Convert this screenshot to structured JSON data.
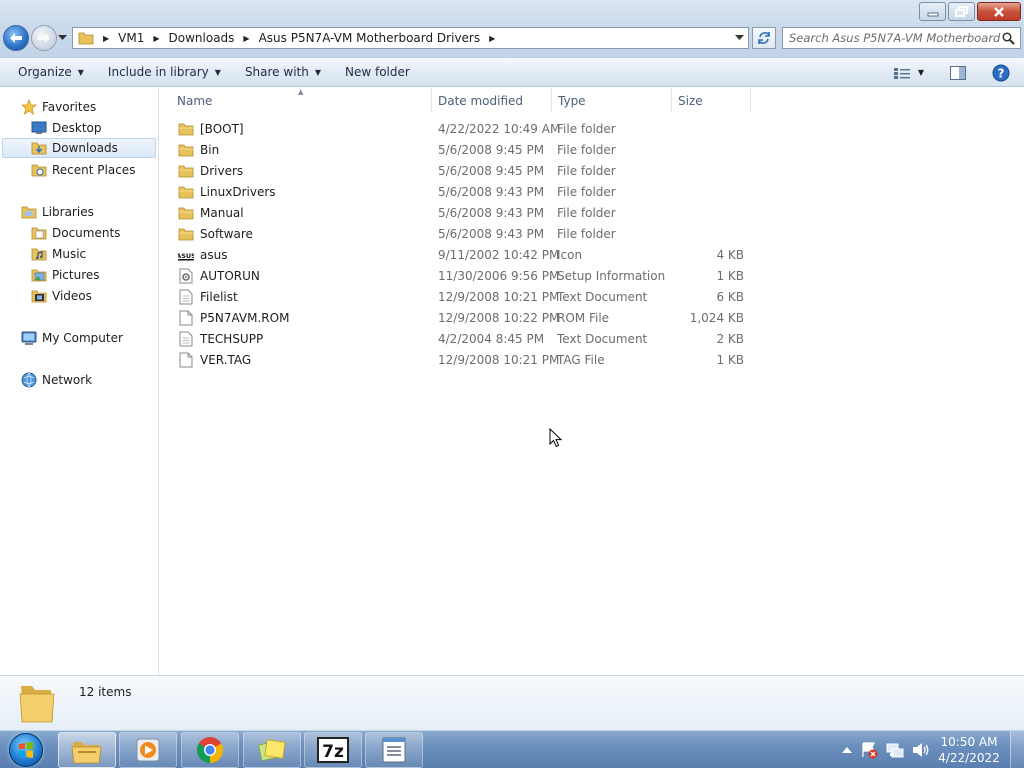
{
  "window": {
    "breadcrumb": [
      "VM1",
      "Downloads",
      "Asus P5N7A-VM Motherboard Drivers"
    ],
    "search_placeholder": "Search Asus P5N7A-VM Motherboard ...",
    "controls": [
      "minimize-icon",
      "maximize-icon",
      "close-icon"
    ]
  },
  "toolbar": {
    "organize": "Organize",
    "include_in_library": "Include in library",
    "share_with": "Share with",
    "new_folder": "New folder",
    "right_icons": [
      "views-icon",
      "preview-pane-icon",
      "help-icon"
    ]
  },
  "nav": {
    "favorites": "Favorites",
    "desktop": "Desktop",
    "downloads": "Downloads",
    "recent_places": "Recent Places",
    "libraries": "Libraries",
    "documents": "Documents",
    "music": "Music",
    "pictures": "Pictures",
    "videos": "Videos",
    "my_computer": "My Computer",
    "network": "Network",
    "selected": "Downloads"
  },
  "columns": {
    "name": "Name",
    "date_modified": "Date modified",
    "type": "Type",
    "size": "Size"
  },
  "files": [
    {
      "name": "[BOOT]",
      "date": "4/22/2022 10:49 AM",
      "type": "File folder",
      "size": "",
      "icon": "folder-icon"
    },
    {
      "name": "Bin",
      "date": "5/6/2008 9:45 PM",
      "type": "File folder",
      "size": "",
      "icon": "folder-icon"
    },
    {
      "name": "Drivers",
      "date": "5/6/2008 9:45 PM",
      "type": "File folder",
      "size": "",
      "icon": "folder-icon"
    },
    {
      "name": "LinuxDrivers",
      "date": "5/6/2008 9:43 PM",
      "type": "File folder",
      "size": "",
      "icon": "folder-icon"
    },
    {
      "name": "Manual",
      "date": "5/6/2008 9:43 PM",
      "type": "File folder",
      "size": "",
      "icon": "folder-icon"
    },
    {
      "name": "Software",
      "date": "5/6/2008 9:43 PM",
      "type": "File folder",
      "size": "",
      "icon": "folder-icon"
    },
    {
      "name": "asus",
      "date": "9/11/2002 10:42 PM",
      "type": "Icon",
      "size": "4 KB",
      "icon": "asus-logo-icon"
    },
    {
      "name": "AUTORUN",
      "date": "11/30/2006 9:56 PM",
      "type": "Setup Information",
      "size": "1 KB",
      "icon": "setup-file-icon"
    },
    {
      "name": "Filelist",
      "date": "12/9/2008 10:21 PM",
      "type": "Text Document",
      "size": "6 KB",
      "icon": "text-file-icon"
    },
    {
      "name": "P5N7AVM.ROM",
      "date": "12/9/2008 10:22 PM",
      "type": "ROM File",
      "size": "1,024 KB",
      "icon": "file-icon"
    },
    {
      "name": "TECHSUPP",
      "date": "4/2/2004 8:45 PM",
      "type": "Text Document",
      "size": "2 KB",
      "icon": "text-file-icon"
    },
    {
      "name": "VER.TAG",
      "date": "12/9/2008 10:21 PM",
      "type": "TAG File",
      "size": "1 KB",
      "icon": "file-icon"
    }
  ],
  "details": {
    "count": "12 items"
  },
  "taskbar": {
    "apps": [
      "file-explorer-icon",
      "media-player-icon",
      "chrome-icon",
      "sticky-notes-icon",
      "7zip-icon",
      "notepad-icon"
    ],
    "active_app": "file-explorer-icon",
    "seven_zip_label": "7z",
    "time": "10:50 AM",
    "date": "4/22/2022"
  },
  "colors": {
    "accent": "#2a6fc4",
    "folder": "#e8c25a",
    "taskbar": "#6b8fbd",
    "secondary_text": "#6d6d6d"
  }
}
